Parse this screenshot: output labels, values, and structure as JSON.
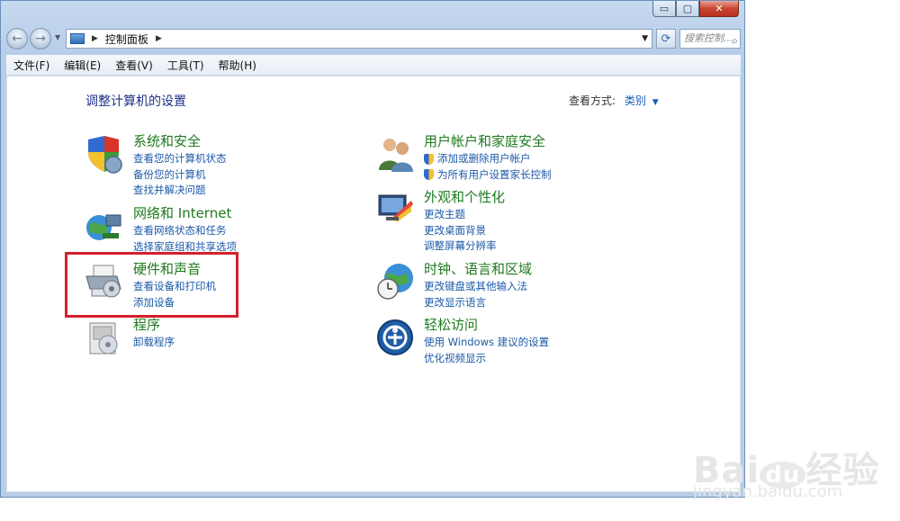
{
  "window": {
    "caption_buttons": {
      "minimize": "▭",
      "maximize": "▢",
      "close": "✕"
    }
  },
  "nav": {
    "back_icon": "arrow-left-icon",
    "forward_icon": "arrow-right-icon",
    "breadcrumb": "控制面板",
    "search_placeholder": "搜索控制..."
  },
  "menu": [
    "文件(F)",
    "编辑(E)",
    "查看(V)",
    "工具(T)",
    "帮助(H)"
  ],
  "content": {
    "title": "调整计算机的设置",
    "view_by_label": "查看方式:",
    "view_by_value": "类别"
  },
  "categories_left": [
    {
      "heading": "系统和安全",
      "icon": "shield-icon",
      "links": [
        "查看您的计算机状态",
        "备份您的计算机",
        "查找并解决问题"
      ]
    },
    {
      "heading": "网络和 Internet",
      "icon": "globe-network-icon",
      "links": [
        "查看网络状态和任务",
        "选择家庭组和共享选项"
      ]
    },
    {
      "heading": "硬件和声音",
      "icon": "printer-icon",
      "links": [
        "查看设备和打印机",
        "添加设备"
      ]
    },
    {
      "heading": "程序",
      "icon": "programs-icon",
      "links": [
        "卸载程序"
      ]
    }
  ],
  "categories_right": [
    {
      "heading": "用户帐户和家庭安全",
      "icon": "users-icon",
      "links": [
        "添加或删除用户帐户",
        "为所有用户设置家长控制"
      ]
    },
    {
      "heading": "外观和个性化",
      "icon": "monitor-icon",
      "links": [
        "更改主题",
        "更改桌面背景",
        "调整屏幕分辨率"
      ]
    },
    {
      "heading": "时钟、语言和区域",
      "icon": "clock-globe-icon",
      "links": [
        "更改键盘或其他输入法",
        "更改显示语言"
      ]
    },
    {
      "heading": "轻松访问",
      "icon": "accessibility-icon",
      "links": [
        "使用 Windows 建议的设置",
        "优化视频显示"
      ]
    }
  ],
  "watermark": {
    "brand_bai": "Bai",
    "brand_du": "du",
    "brand_suffix": "经验",
    "url": "jingyan.baidu.com"
  },
  "colors": {
    "heading_green": "#1e7a1e",
    "link_blue": "#1c5aa8",
    "title_blue": "#1e3287",
    "highlight_red": "#d4202d"
  }
}
